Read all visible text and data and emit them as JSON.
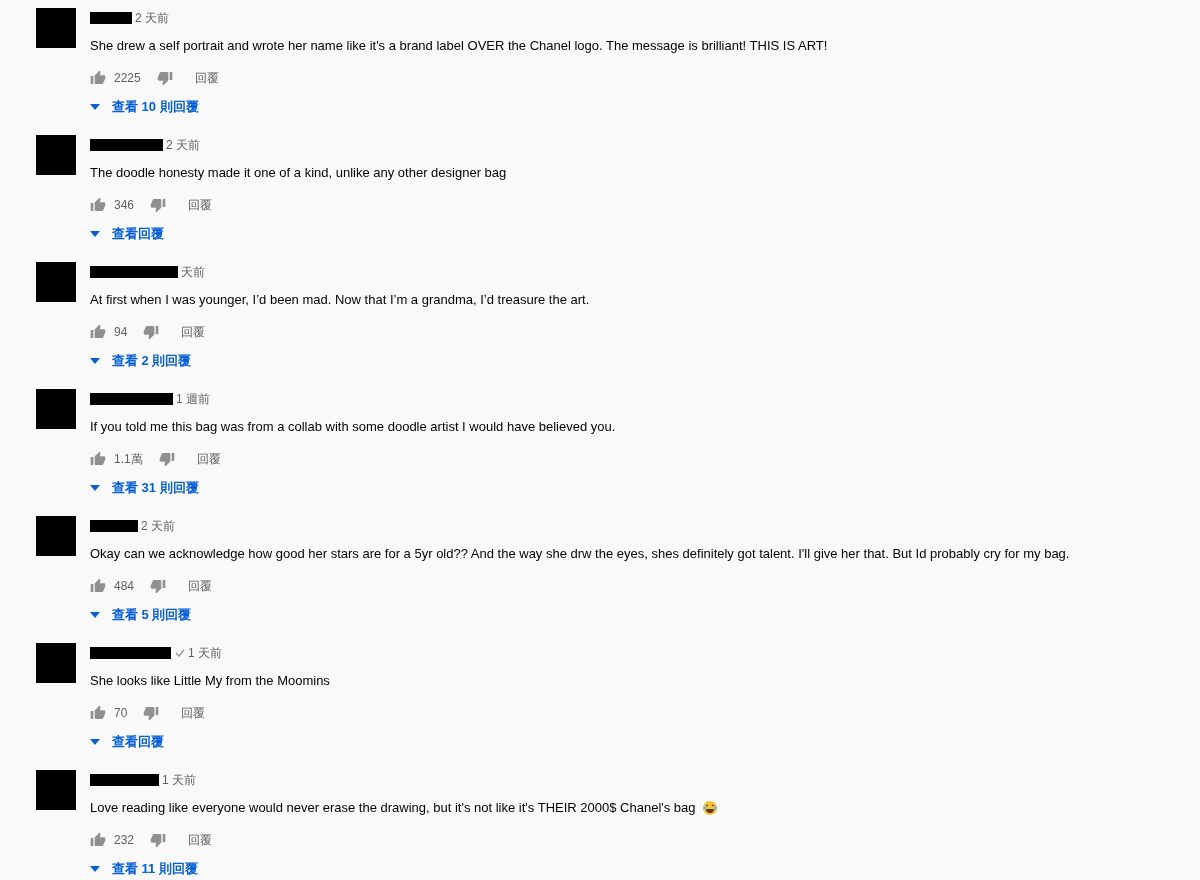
{
  "comments": [
    {
      "time": "2 天前",
      "verified": false,
      "text": "She drew a self portrait and wrote her name like it's a brand label OVER the Chanel logo. The message is brilliant! THIS IS ART!",
      "likes": "2225",
      "reply_label": "回覆",
      "view_replies": "查看 10 則回覆"
    },
    {
      "time": "2 天前",
      "verified": false,
      "text": "The doodle honesty made it one of a kind, unlike any other designer bag",
      "likes": "346",
      "reply_label": "回覆",
      "view_replies": "查看回覆"
    },
    {
      "time": "天前",
      "verified": false,
      "text": "At first when I was younger, I’d been mad. Now that I’m a grandma, I’d treasure the art.",
      "likes": "94",
      "reply_label": "回覆",
      "view_replies": "查看 2 則回覆"
    },
    {
      "time": "1 週前",
      "verified": false,
      "text": "If you told me this bag was from a collab with some doodle artist I would have believed you.",
      "likes": "1.1萬",
      "reply_label": "回覆",
      "view_replies": "查看 31 則回覆"
    },
    {
      "time": "2 天前",
      "verified": false,
      "text": "Okay can we acknowledge how good her stars are for a 5yr old?? And the way she drw the eyes, shes definitely got talent. I'll give her that. But Id probably cry for my bag.",
      "likes": "484",
      "reply_label": "回覆",
      "view_replies": "查看 5 則回覆"
    },
    {
      "time": "1 天前",
      "verified": true,
      "text": "She looks like Little My from the Moomins",
      "likes": "70",
      "reply_label": "回覆",
      "view_replies": "查看回覆"
    },
    {
      "time": "1 天前",
      "verified": false,
      "text": "Love reading like everyone would never erase the drawing, but it's not like it's THEIR 2000$ Chanel's bag",
      "laughing_emoji": true,
      "likes": "232",
      "reply_label": "回覆",
      "view_replies": "查看 11 則回覆"
    }
  ]
}
